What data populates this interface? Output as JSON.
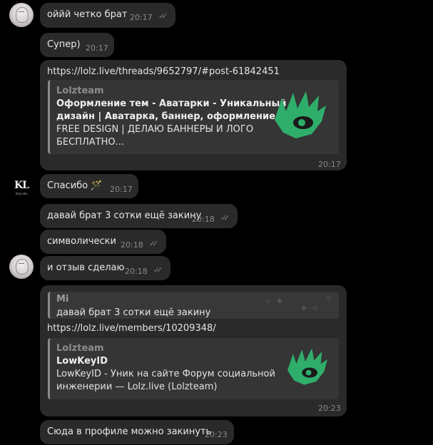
{
  "messages": [
    {
      "text": "оййй четко брат",
      "time": "20:17",
      "read": true
    },
    {
      "text": "Супер)",
      "time": "20:17"
    },
    {
      "link": "https://lolz.live/threads/9652797/#post-61842451",
      "preview": {
        "site": "Lolzteam",
        "title_line1": "Оформление тем - Аватарки - Уникальный",
        "title_line2": "дизайн | Аватарка, баннер, оформление т…",
        "desc_line1": "FREE DESIGN | ДЕЛАЮ БАННЕРЫ И ЛОГО",
        "desc_line2": "БЕСПЛАТНО..."
      },
      "time": "20:17"
    },
    {
      "text": "Спасибо 🪄",
      "time": "20:17"
    },
    {
      "text": "давай брат 3 сотки ещё закину",
      "time": "20:18",
      "read": true
    },
    {
      "text": "символически",
      "time": "20:18",
      "read": true
    },
    {
      "text": "и отзыв сделаю",
      "time": "20:18",
      "read": true
    },
    {
      "reply": {
        "name": "Mi",
        "text": "давай брат 3 сотки ещё закину"
      },
      "link": "https://lolz.live/members/10209348/",
      "preview": {
        "site": "Lolzteam",
        "title_line1": "LowKeyID",
        "desc_line1": "LowKeyID - Уник на сайте Форум социальной",
        "desc_line2": "инженерии —  Lolz.live (Lolzteam)"
      },
      "time": "20:23"
    },
    {
      "text": "Сюда в профиле можно закинуть",
      "time": "20:23"
    }
  ],
  "avatars": {
    "contact_logo_text": "KL",
    "contact_logo_subtext": "KeyLabs"
  },
  "colors": {
    "background": "#000000",
    "bubble": "#2a2a2a",
    "preview_bg": "#353535",
    "accent_green": "#2fae6b"
  },
  "icons": {
    "read_receipt": "double-check-icon",
    "site_logo": "lolzteam-eye-logo-icon"
  }
}
